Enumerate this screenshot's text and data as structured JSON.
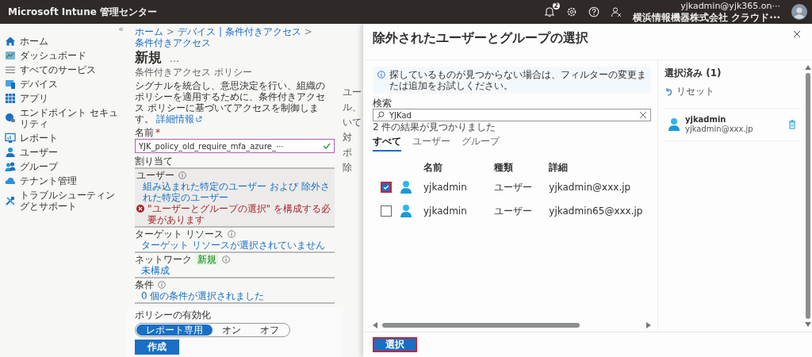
{
  "top_bar": {
    "title": "Microsoft Intune 管理センター",
    "notification_count": "2",
    "account": "yjkadmin@yjk365.on···",
    "organization": "横浜情報機器株式会社 クラウド···"
  },
  "sidebar": {
    "collapse": "«",
    "items": [
      {
        "label": "ホーム"
      },
      {
        "label": "ダッシュボード"
      },
      {
        "label": "すべてのサービス"
      },
      {
        "label": "デバイス"
      },
      {
        "label": "アプリ"
      },
      {
        "label": "エンドポイント セキュリティ"
      },
      {
        "label": "レポート"
      },
      {
        "label": "ユーザー"
      },
      {
        "label": "グループ"
      },
      {
        "label": "テナント管理"
      },
      {
        "label": "トラブルシューティングとサポート"
      }
    ]
  },
  "form": {
    "breadcrumb": [
      "ホーム",
      "デバイス | 条件付きアクセス",
      "条件付きアクセス"
    ],
    "separator": ">",
    "title": "新規",
    "more": "…",
    "subtitle": "条件付きアクセス ポリシー",
    "description": "シグナルを統合し、意思決定を行い、組織のポリシーを適用するために、条件付きアクセス ポリシーに基づいてアクセスを制御します。",
    "description_link": "詳細情報",
    "name_label": "名前",
    "required_mark": "*",
    "name_value": "YJK_policy_old_require_mfa_azure_···",
    "assignments_heading": "割り当て",
    "sections": [
      {
        "label": "ユーザー",
        "link": "組み込まれた特定のユーザー および 除外された特定のユーザー",
        "error": "\"ユーザーとグループの選択\" を構成する必要があります"
      },
      {
        "label": "ターゲット リソース",
        "link": "ターゲット リソースが選択されていません"
      },
      {
        "label": "ネットワーク",
        "badge": "新規",
        "link": "未構成"
      },
      {
        "label": "条件",
        "link": "0 個の条件が選択されました"
      }
    ],
    "policy": {
      "label": "ポリシーの有効化",
      "options": [
        {
          "label": "レポート専用",
          "selected": true
        },
        {
          "label": "オン",
          "selected": false
        },
        {
          "label": "オフ",
          "selected": false
        }
      ]
    },
    "create_button": "作成"
  },
  "hidden_column": [
    "ユー",
    "ル、",
    "いて",
    "対",
    "ポ",
    "除"
  ],
  "panel": {
    "title": "除外されたユーザーとグループの選択",
    "info": "探しているものが見つからない場合は、フィルターの変更または追加をお試しください。",
    "search_label": "検索",
    "search_value": "YJKad",
    "result_count": "2 件の結果が見つかりました",
    "tabs": [
      {
        "label": "すべて",
        "selected": true
      },
      {
        "label": "ユーザー",
        "selected": false
      },
      {
        "label": "グループ",
        "selected": false
      }
    ],
    "columns": [
      "名前",
      "種類",
      "詳細"
    ],
    "rows": [
      {
        "name": "yjkadmin",
        "type": "ユーザー",
        "detail": "yjkadmin@xxx.jp",
        "checked": true,
        "highlighted": true
      },
      {
        "name": "yjkadmin",
        "type": "ユーザー",
        "detail": "yjkadmin65@xxx.jp",
        "checked": false,
        "highlighted": false
      }
    ],
    "selected": {
      "heading": "選択済み (1)",
      "reset": "リセット",
      "items": [
        {
          "name": "yjkadmin",
          "detail": "yjkadmin@xxx.jp"
        }
      ]
    },
    "select_button": {
      "label": "選択",
      "highlighted": true
    }
  }
}
